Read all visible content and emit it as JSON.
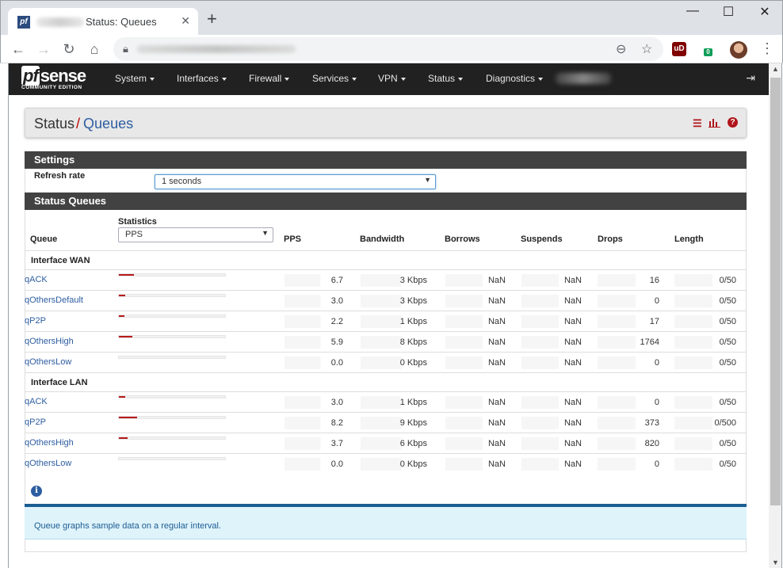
{
  "browser": {
    "tab_title": "Status: Queues",
    "tab_favicon": "pf",
    "new_tab": "+",
    "close": "✕",
    "minimize": "—",
    "maximize": "☐",
    "window_close": "✕",
    "ext_ublock_label": "uD",
    "ext_badge": "0"
  },
  "navbar": {
    "logo_pf": "pf",
    "logo_main": "sense",
    "logo_sub": "COMMUNITY EDITION",
    "menu": [
      "System",
      "Interfaces",
      "Firewall",
      "Services",
      "VPN",
      "Status",
      "Diagnostics"
    ]
  },
  "breadcrumb": {
    "section": "Status",
    "separator": "/",
    "page": "Queues"
  },
  "settings": {
    "heading": "Settings",
    "refresh_label": "Refresh rate",
    "refresh_value": "1 seconds"
  },
  "status_queues": {
    "heading": "Status Queues",
    "statistics_label": "Statistics",
    "statistics_value": "PPS",
    "columns": [
      "Queue",
      "PPS",
      "Bandwidth",
      "Borrows",
      "Suspends",
      "Drops",
      "Length"
    ],
    "groups": [
      {
        "label": "Interface WAN",
        "rows": [
          {
            "name": "qACK",
            "level": 0.14,
            "pps": "6.7",
            "bandwidth": "3 Kbps",
            "borrows": "NaN",
            "suspends": "NaN",
            "drops": "16",
            "length": "0/50"
          },
          {
            "name": "qOthersDefault",
            "level": 0.06,
            "pps": "3.0",
            "bandwidth": "3 Kbps",
            "borrows": "NaN",
            "suspends": "NaN",
            "drops": "0",
            "length": "0/50"
          },
          {
            "name": "qP2P",
            "level": 0.05,
            "pps": "2.2",
            "bandwidth": "1 Kbps",
            "borrows": "NaN",
            "suspends": "NaN",
            "drops": "17",
            "length": "0/50"
          },
          {
            "name": "qOthersHigh",
            "level": 0.13,
            "pps": "5.9",
            "bandwidth": "8 Kbps",
            "borrows": "NaN",
            "suspends": "NaN",
            "drops": "1764",
            "length": "0/50"
          },
          {
            "name": "qOthersLow",
            "level": 0.0,
            "pps": "0.0",
            "bandwidth": "0 Kbps",
            "borrows": "NaN",
            "suspends": "NaN",
            "drops": "0",
            "length": "0/50"
          }
        ]
      },
      {
        "label": "Interface LAN",
        "rows": [
          {
            "name": "qACK",
            "level": 0.06,
            "pps": "3.0",
            "bandwidth": "1 Kbps",
            "borrows": "NaN",
            "suspends": "NaN",
            "drops": "0",
            "length": "0/50"
          },
          {
            "name": "qP2P",
            "level": 0.17,
            "pps": "8.2",
            "bandwidth": "9 Kbps",
            "borrows": "NaN",
            "suspends": "NaN",
            "drops": "373",
            "length": "0/500"
          },
          {
            "name": "qOthersHigh",
            "level": 0.08,
            "pps": "3.7",
            "bandwidth": "6 Kbps",
            "borrows": "NaN",
            "suspends": "NaN",
            "drops": "820",
            "length": "0/50"
          },
          {
            "name": "qOthersLow",
            "level": 0.0,
            "pps": "0.0",
            "bandwidth": "0 Kbps",
            "borrows": "NaN",
            "suspends": "NaN",
            "drops": "0",
            "length": "0/50"
          }
        ]
      }
    ]
  },
  "info": {
    "icon": "info-icon",
    "text": "Queue graphs sample data on a regular interval."
  },
  "colors": {
    "navbar": "#212121",
    "panel_heading": "#424242",
    "link": "#2d5da1",
    "bar": "#b81a1a",
    "info_bg": "#dff3fb"
  }
}
